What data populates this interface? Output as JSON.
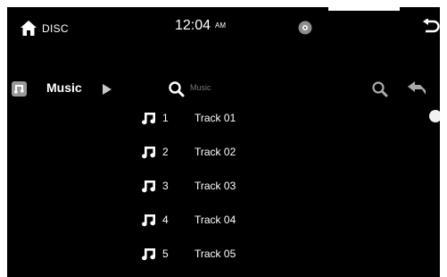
{
  "header": {
    "source_label": "DISC",
    "time": "12:04",
    "ampm": "AM",
    "icons": {
      "home": "home-icon",
      "disc": "disc-icon",
      "back": "back-icon"
    }
  },
  "browser": {
    "category_label": "Music",
    "search_placeholder": "Music",
    "icons": {
      "category": "music-note-icon",
      "expand": "play-arrow-icon",
      "search": "search-icon",
      "return": "return-arrow-icon"
    }
  },
  "tracks": [
    {
      "number": "1",
      "title": "Track 01"
    },
    {
      "number": "2",
      "title": "Track 02"
    },
    {
      "number": "3",
      "title": "Track 03"
    },
    {
      "number": "4",
      "title": "Track 04"
    },
    {
      "number": "5",
      "title": "Track 05"
    }
  ],
  "colors": {
    "background": "#000000",
    "text": "#ffffff",
    "placeholder": "#777777",
    "icon_gray": "#aaaaaa"
  }
}
